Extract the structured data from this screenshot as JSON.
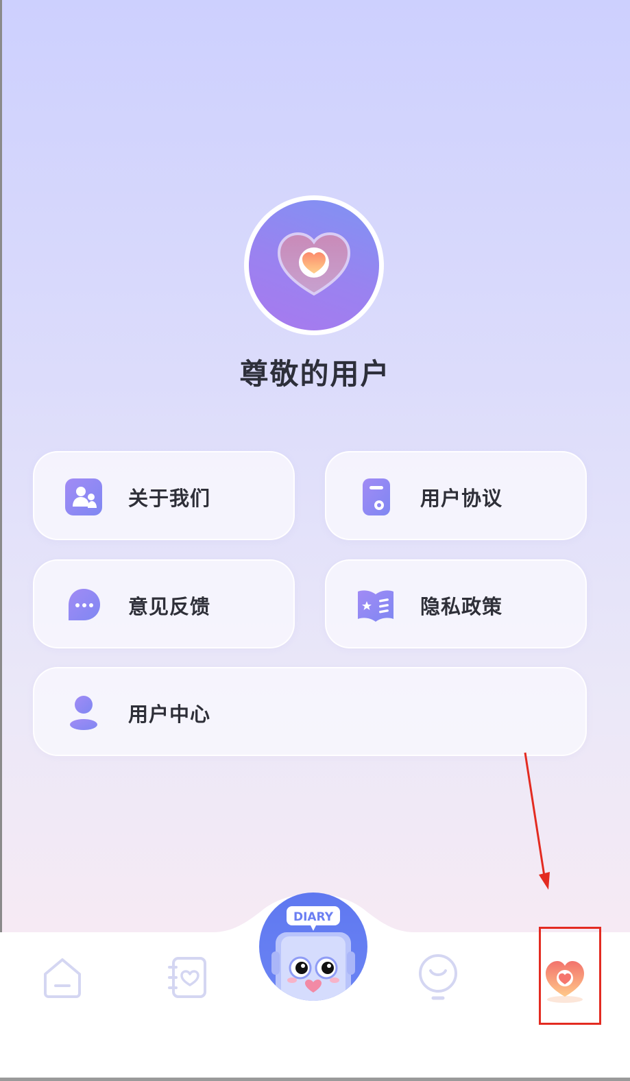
{
  "profile": {
    "username": "尊敬的用户"
  },
  "menu": {
    "about_us": {
      "label": "关于我们",
      "icon": "people-icon"
    },
    "user_agreement": {
      "label": "用户协议",
      "icon": "document-icon"
    },
    "feedback": {
      "label": "意见反馈",
      "icon": "chat-bubble-icon"
    },
    "privacy_policy": {
      "label": "隐私政策",
      "icon": "book-star-icon"
    },
    "user_center": {
      "label": "用户中心",
      "icon": "person-icon"
    }
  },
  "bottom_nav": {
    "items": [
      {
        "name": "home",
        "icon": "home-icon"
      },
      {
        "name": "diary",
        "icon": "heart-notebook-icon"
      },
      {
        "name": "center",
        "icon": "diary-robot-icon",
        "badge_text": "DIARY"
      },
      {
        "name": "ideas",
        "icon": "lightbulb-icon"
      },
      {
        "name": "mine",
        "icon": "heart-icon",
        "active": true
      }
    ]
  },
  "colors": {
    "accent": "#8b82f2",
    "annotation": "#e32b21",
    "active_heart": "#f2736c"
  }
}
